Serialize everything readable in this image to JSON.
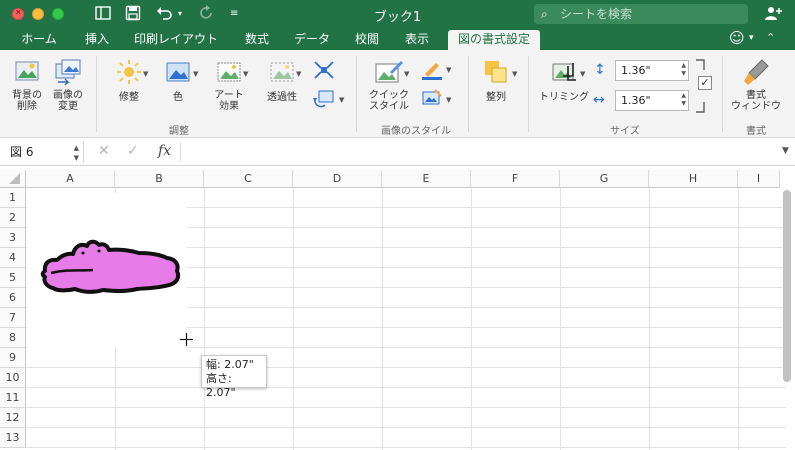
{
  "titlebar": {
    "title": "ブック1",
    "search_placeholder": "シートを検索"
  },
  "tabs": [
    {
      "label": "ホーム"
    },
    {
      "label": "挿入"
    },
    {
      "label": "印刷レイアウト"
    },
    {
      "label": "数式"
    },
    {
      "label": "データ"
    },
    {
      "label": "校閲"
    },
    {
      "label": "表示"
    },
    {
      "label": "図の書式設定"
    }
  ],
  "ribbon": {
    "remove_bg": "背景の\n削除",
    "change_picture": "画像の\n変更",
    "corrections": "修整",
    "color": "色",
    "artistic": "アート\n効果",
    "transparency": "透過性",
    "quick_styles": "クイック\nスタイル",
    "arrange": "整列",
    "crop": "トリミング",
    "height_value": "1.36\"",
    "width_value": "1.36\"",
    "format_pane": "書式\nウィンドウ",
    "group_adjust": "調整",
    "group_styles": "画像のスタイル",
    "group_size": "サイズ",
    "group_format": "書式"
  },
  "formulabar": {
    "namebox": "図 6",
    "fx": "fx"
  },
  "columns": [
    "A",
    "B",
    "C",
    "D",
    "E",
    "F",
    "G",
    "H",
    "I"
  ],
  "rows": [
    "1",
    "2",
    "3",
    "4",
    "5",
    "6",
    "7",
    "8",
    "9",
    "10",
    "11",
    "12",
    "13"
  ],
  "tooltip": {
    "width_line": "幅:  2.07\"",
    "height_line": "高さ:  2.07\""
  },
  "colors": {
    "accent": "#217346",
    "picture_fill": "#e77be8"
  }
}
